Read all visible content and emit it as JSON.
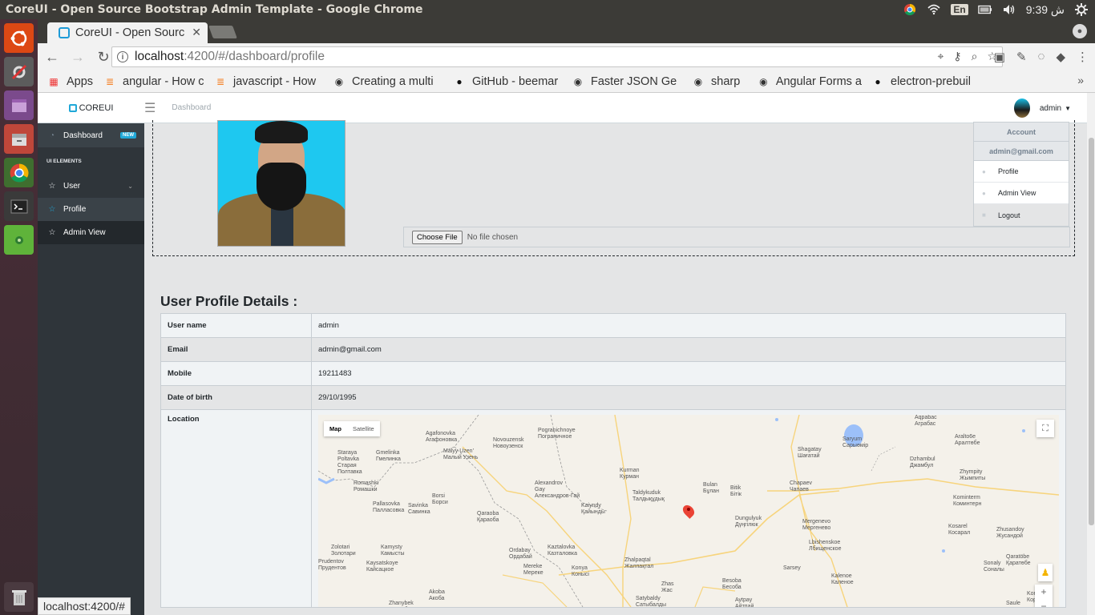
{
  "os": {
    "window_title": "CoreUI - Open Source Bootstrap Admin Template - Google Chrome",
    "lang": "En",
    "clock": "9:39 ﺵ"
  },
  "chrome": {
    "tab_title": "CoreUI - Open Sourc",
    "url_host": "localhost",
    "url_path": ":4200/#/dashboard/profile",
    "bookmarks": [
      {
        "label": "Apps",
        "icon": "apps-grid-icon"
      },
      {
        "label": "angular - How c",
        "icon": "stackoverflow-icon"
      },
      {
        "label": "javascript - How",
        "icon": "stackoverflow-icon"
      },
      {
        "label": "Creating a multi",
        "icon": "site-icon"
      },
      {
        "label": "GitHub - beemar",
        "icon": "github-icon"
      },
      {
        "label": "Faster JSON Ge",
        "icon": "site-icon"
      },
      {
        "label": "sharp",
        "icon": "site-icon"
      },
      {
        "label": "Angular Forms a",
        "icon": "site-icon"
      },
      {
        "label": "electron-prebuil",
        "icon": "github-icon"
      }
    ],
    "status_text": "localhost:4200/#"
  },
  "app": {
    "brand": "COREUI",
    "breadcrumb": "Dashboard",
    "username": "admin",
    "sidebar": {
      "dashboard": "Dashboard",
      "badge": "NEW",
      "section_title": "UI ELEMENTS",
      "user": "User",
      "profile": "Profile",
      "admin_view": "Admin View"
    },
    "dropdown": {
      "header": "Account",
      "email": "admin@gmail.com",
      "profile": "Profile",
      "admin_view": "Admin View",
      "logout": "Logout"
    },
    "upload": {
      "button": "Choose File",
      "status": "No file chosen"
    },
    "details": {
      "title": "User Profile Details :",
      "rows": [
        {
          "label": "User name",
          "value": "admin"
        },
        {
          "label": "Email",
          "value": "admin@gmail.com"
        },
        {
          "label": "Mobile",
          "value": "19211483"
        },
        {
          "label": "Date of birth",
          "value": "29/10/1995"
        }
      ],
      "location_label": "Location"
    },
    "map": {
      "map_btn": "Map",
      "satellite_btn": "Satellite",
      "labels": [
        "Staraya\nPoltavka\nСтарая\nПолтавка",
        "Gmelinka\nГмелинка",
        "Agafonovka\nАгафоновка",
        "Malyy Uzen'\nМалый Узень",
        "Novouzensk\nНовоузенск",
        "Pogranichnoye\nПограничное",
        "Romashki\nРомашки",
        "Pallasovka\nПалласовка",
        "Savinka\nСавинка",
        "Borsi\nБорси",
        "Qaraoba\nҚараоба",
        "Alexandrov\nGay\nАлександров-Гай",
        "Kaiyndy\nҚайынды",
        "Kurman\nКурман",
        "Taldykuduk\nТалдықұдық",
        "Bulan\nБұлан",
        "Bitik\nБітік",
        "Chapaev\nЧапаев",
        "Shagatay\nШағатай",
        "Saryum\nСарыөмір",
        "Dzhambul\nДжамбул",
        "Aralto6e\nАралтөбе",
        "Zhympity\nЖымпиты",
        "Kominterm\nКоминтерн",
        "Mergenevo\nМергенево",
        "Dungulyuk\nДүңгілюк",
        "Zolotari\nЗолотари",
        "Kamysty\nКамысты",
        "Ordabay\nОрдабай",
        "Kaztalovka\nКазталовка",
        "Zhalpaqtal\nЖалпақтал",
        "Lbishenskoe\nЛбищенское",
        "Kosarel\nКосарал",
        "Zhusandoy\nЖусандой",
        "Prudentov\nПрудентов",
        "Kaysatskoye\nКайсацкое",
        "Mereke\nМереке",
        "Konya\nКонысі",
        "Zhas\nЖас",
        "Besoba\nБесоба",
        "Kalenoe\nКаленое",
        "Sarsey",
        "Sonaly\nСоналы",
        "Qaratöbe\nҚаратөбе",
        "Akoba\nАкоба",
        "Satybaldy\nСатыбалды",
        "Aytpay\nАйтпай",
        "Saule\nСауле",
        "Korzhyn\nКоржын",
        "Zhanybek\nЖаныбек",
        "Aqpabac\nАграбас"
      ]
    }
  },
  "colors": {
    "accent": "#20a8d8",
    "sidebar": "#2f353a",
    "pin": "#ea4335"
  }
}
